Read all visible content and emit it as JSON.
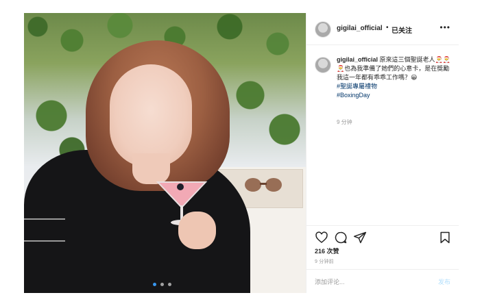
{
  "header": {
    "username": "gigilai_official",
    "separator": "•",
    "follow_status": "已关注",
    "more_label": "•••"
  },
  "caption": {
    "username": "gigilai_official",
    "text": "原來這三個聖誕老人🎅🎅🎅也為我準備了她們的心意卡，是在獎勵我這一年都有乖乖工作嗎？😀",
    "hashtags": [
      "#聖誕專屬禮物",
      "#BoxingDay"
    ],
    "time": "9 分钟"
  },
  "stats": {
    "likes": "216 次赞",
    "time_ago": "9 分钟前"
  },
  "comment_box": {
    "placeholder": "添加评论...",
    "post_label": "发布"
  },
  "icons": {
    "like": "heart-icon",
    "comment": "comment-icon",
    "share": "send-icon",
    "save": "bookmark-icon",
    "more": "more-icon"
  },
  "carousel": {
    "count": 3,
    "active_index": 1
  },
  "colors": {
    "link": "#003569",
    "post_button": "#b2dffc",
    "active_dot": "#3897f0"
  }
}
